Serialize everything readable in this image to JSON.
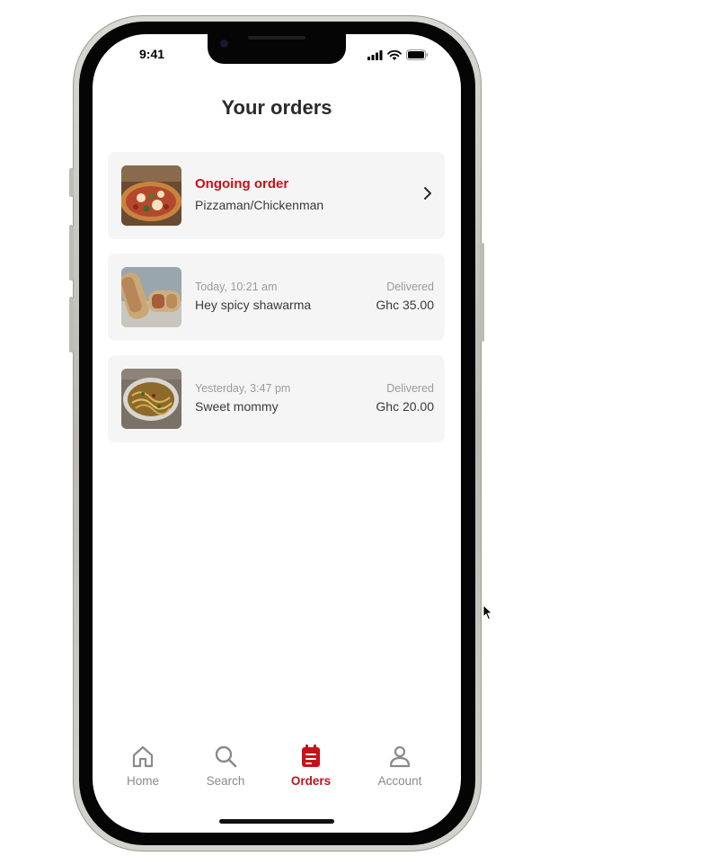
{
  "status_bar": {
    "time": "9:41"
  },
  "page": {
    "title": "Your orders"
  },
  "ongoing": {
    "heading": "Ongoing order",
    "restaurant": "Pizzaman/Chickenman"
  },
  "orders": [
    {
      "time": "Today, 10:21 am",
      "name": "Hey spicy shawarma",
      "status": "Delivered",
      "price": "Ghc 35.00"
    },
    {
      "time": "Yesterday, 3:47 pm",
      "name": "Sweet mommy",
      "status": "Delivered",
      "price": "Ghc 20.00"
    }
  ],
  "tabs": [
    {
      "label": "Home",
      "icon": "home-icon"
    },
    {
      "label": "Search",
      "icon": "search-icon"
    },
    {
      "label": "Orders",
      "icon": "orders-icon",
      "active": true
    },
    {
      "label": "Account",
      "icon": "account-icon"
    }
  ],
  "colors": {
    "accent": "#c8111b",
    "card_bg": "#f5f5f5",
    "muted": "#9b9b9b"
  }
}
